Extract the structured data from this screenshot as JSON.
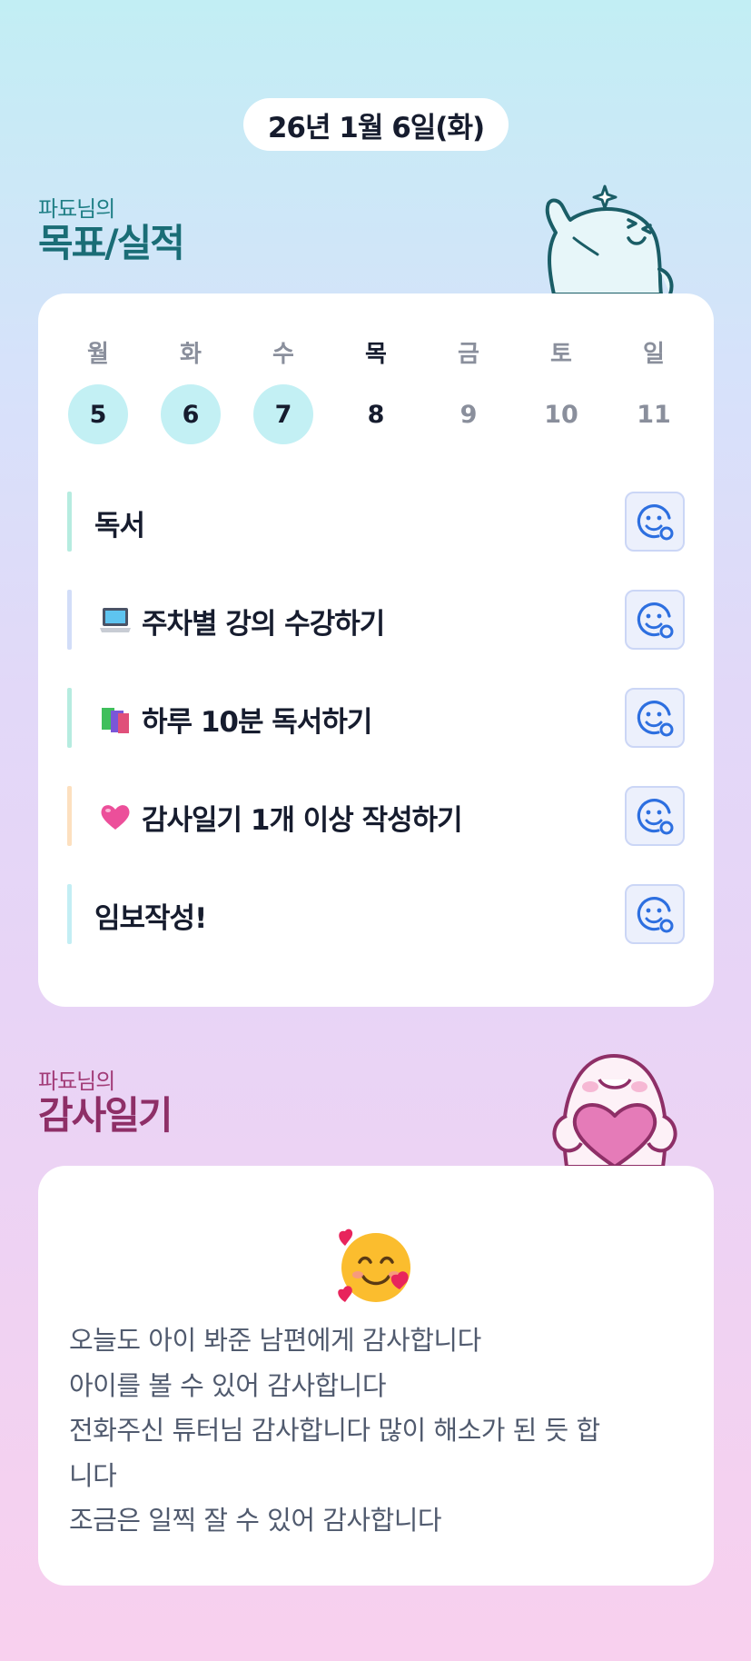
{
  "date": "26년 1월 6일(화)",
  "goals_section": {
    "subtitle": "파됴님의",
    "title": "목표/실적"
  },
  "week": [
    {
      "day": "월",
      "date": "5",
      "state": "done"
    },
    {
      "day": "화",
      "date": "6",
      "state": "done"
    },
    {
      "day": "수",
      "date": "7",
      "state": "done"
    },
    {
      "day": "목",
      "date": "8",
      "state": "today"
    },
    {
      "day": "금",
      "date": "9",
      "state": "upcoming"
    },
    {
      "day": "토",
      "date": "10",
      "state": "upcoming"
    },
    {
      "day": "일",
      "date": "11",
      "state": "upcoming"
    }
  ],
  "goals": [
    {
      "text": "독서",
      "emoji": "",
      "accent": "#b6ece0"
    },
    {
      "text": "주차별 강의 수강하기",
      "emoji": "laptop-icon",
      "accent": "#d2ddf8"
    },
    {
      "text": "하루 10분 독서하기",
      "emoji": "books-icon",
      "accent": "#b6ece0"
    },
    {
      "text": "감사일기 1개 이상 작성하기",
      "emoji": "pink-heart-icon",
      "accent": "#fde0bf"
    },
    {
      "text": "임보작성!",
      "emoji": "",
      "accent": "#c3eef4"
    }
  ],
  "react_button_icon": "smiley-add-icon",
  "gratitude_section": {
    "subtitle": "파됴님의",
    "title": "감사일기"
  },
  "gratitude": {
    "emoji": "smiling-face-with-hearts-icon",
    "lines": [
      "오늘도 아이 봐준 남편에게 감사합니다",
      "아이를 볼 수 있어 감사합니다",
      "전화주신 튜터님 감사합니다 많이 해소가 된 듯 합",
      "니다",
      "조금은 일찍 잘 수 있어 감사합니다"
    ]
  },
  "colors": {
    "accent_teal": "#1a6d76",
    "accent_plum": "#8e2f67",
    "done_circle": "#c3f0f4",
    "react_button_bg": "#ecf0fc",
    "react_icon": "#2d6fe0"
  }
}
